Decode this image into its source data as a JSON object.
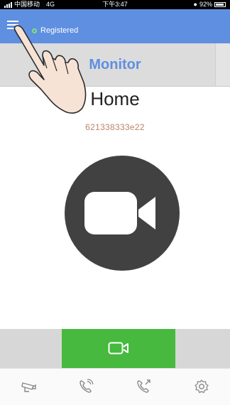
{
  "status_bar": {
    "carrier": "中国移动",
    "network": "4G",
    "time": "下午3:47",
    "battery": "92%",
    "battery_level": 0.92
  },
  "header": {
    "menu_icon": "menu-icon",
    "registration_status": "Registered",
    "status_color": "#7ee07a",
    "accent": "#5f8fe0"
  },
  "monitor": {
    "title": "Monitor",
    "device_name": "Home",
    "device_id": "621338333e22",
    "camera_icon": "video-camera-icon"
  },
  "actions": {
    "video_icon": "video-camera-outline-icon",
    "video_color": "#46b93e"
  },
  "tabs": [
    {
      "icon": "cctv-camera-icon"
    },
    {
      "icon": "phone-incoming-icon"
    },
    {
      "icon": "phone-outgoing-icon"
    },
    {
      "icon": "settings-gear-icon"
    }
  ]
}
